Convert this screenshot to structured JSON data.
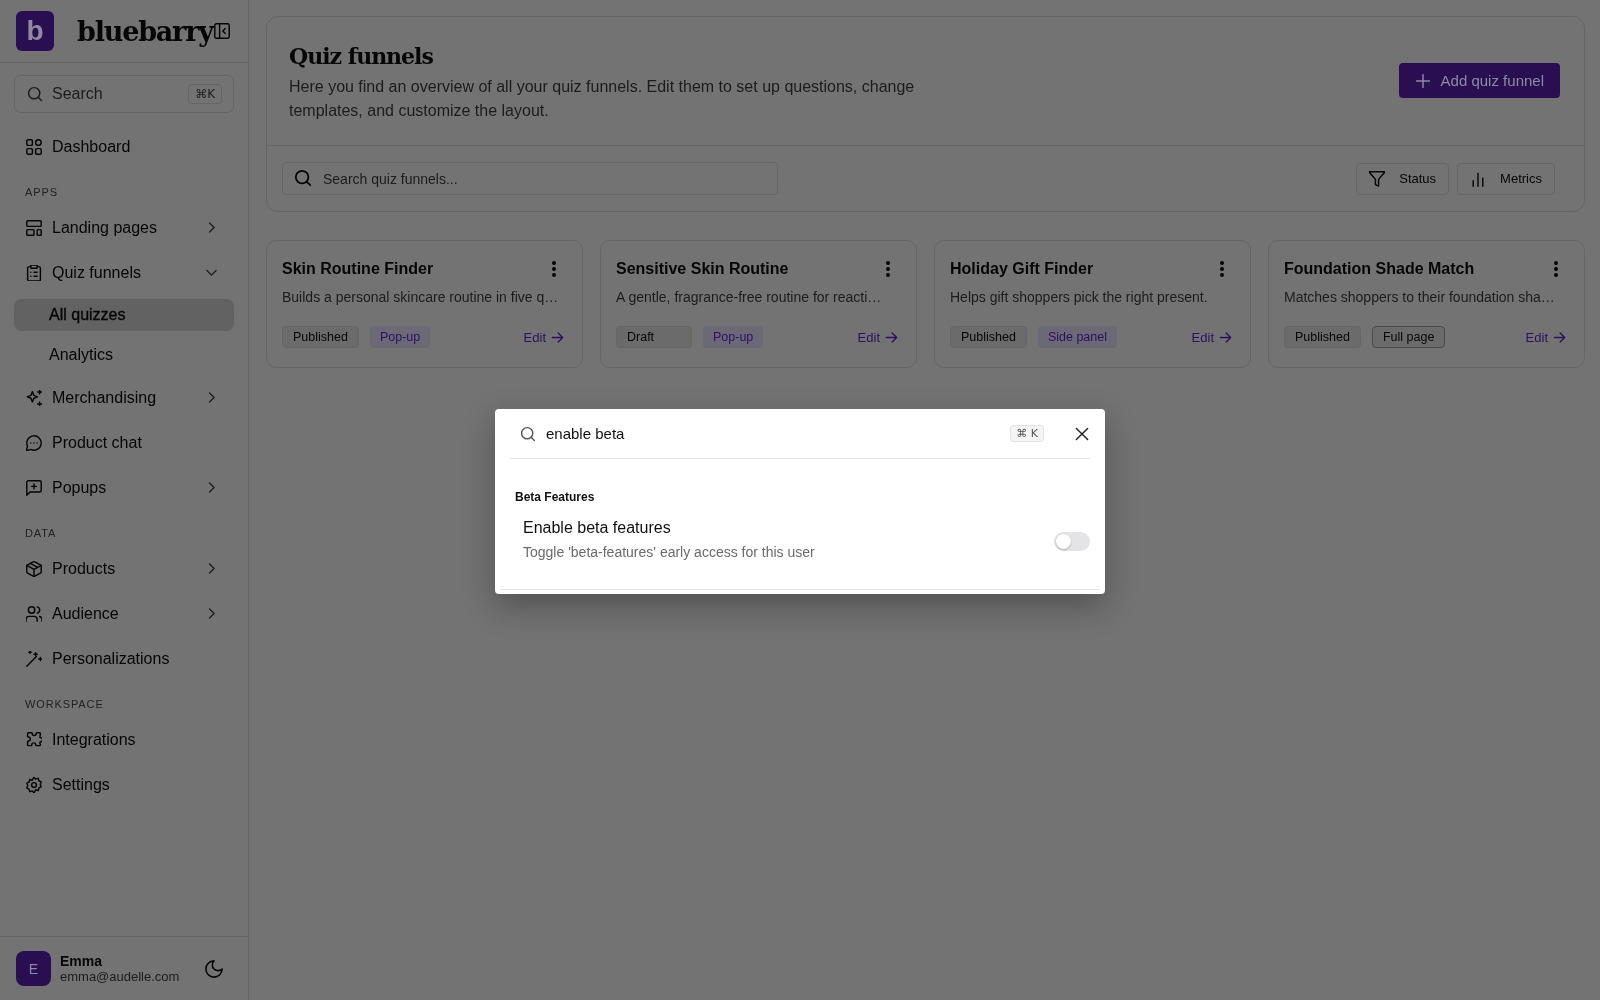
{
  "sidebar": {
    "logo_letter": "b",
    "brand": "bluebarry",
    "search": {
      "placeholder": "Search",
      "shortcut": "⌘K"
    },
    "sections": [
      {
        "items": [
          {
            "label": "Dashboard",
            "kind": "link",
            "selected": false
          }
        ]
      },
      {
        "label": "APPS",
        "items": [
          {
            "label": "Landing pages",
            "kind": "menu",
            "expanded": false,
            "selected": false
          },
          {
            "label": "Quiz funnels",
            "kind": "menu",
            "expanded": true,
            "selected": false,
            "children": [
              {
                "label": "All quizzes",
                "selected": true
              },
              {
                "label": "Analytics",
                "selected": false
              }
            ]
          },
          {
            "label": "Merchandising",
            "kind": "menu",
            "expanded": false,
            "selected": false
          },
          {
            "label": "Product chat",
            "kind": "link",
            "selected": false
          },
          {
            "label": "Popups",
            "kind": "menu",
            "expanded": false,
            "selected": false
          }
        ]
      },
      {
        "label": "DATA",
        "items": [
          {
            "label": "Products",
            "kind": "menu",
            "expanded": false,
            "selected": false
          },
          {
            "label": "Audience",
            "kind": "menu",
            "expanded": false,
            "selected": false
          },
          {
            "label": "Personalizations",
            "kind": "link",
            "selected": false
          }
        ]
      },
      {
        "label": "WORKSPACE",
        "items": [
          {
            "label": "Integrations",
            "kind": "link",
            "selected": false
          },
          {
            "label": "Settings",
            "kind": "link",
            "selected": false
          }
        ]
      }
    ],
    "user": {
      "avatar_letter": "E",
      "name": "Emma",
      "email": "emma@audelle.com"
    }
  },
  "header": {
    "title": "Quiz funnels",
    "description": "Here you find an overview of all your quiz funnels. Edit them to set up questions, change templates, and customize the layout.",
    "action": "Add quiz funnel"
  },
  "toolbar": {
    "search": {
      "placeholder": "Search quiz funnels..."
    },
    "filters": [
      {
        "label": "Status"
      },
      {
        "label": "Metrics"
      }
    ]
  },
  "cards": [
    {
      "title": "Skin Routine Finder",
      "description": "Builds a personal skincare routine in five q…",
      "badges": [
        {
          "label": "Published",
          "kind": "status"
        },
        {
          "label": "Pop-up",
          "kind": "accent"
        }
      ],
      "link": "Edit"
    },
    {
      "title": "Sensitive Skin Routine",
      "description": "A gentle, fragrance-free routine for reacti…",
      "badges": [
        {
          "label": "Draft",
          "kind": "status"
        },
        {
          "label": "Pop-up",
          "kind": "accent"
        }
      ],
      "link": "Edit"
    },
    {
      "title": "Holiday Gift Finder",
      "description": "Helps gift shoppers pick the right present.",
      "badges": [
        {
          "label": "Published",
          "kind": "status"
        },
        {
          "label": "Side panel",
          "kind": "accent"
        }
      ],
      "link": "Edit"
    },
    {
      "title": "Foundation Shade Match",
      "description": "Matches shoppers to their foundation sha…",
      "badges": [
        {
          "label": "Published",
          "kind": "status"
        },
        {
          "label": "Full page",
          "kind": "outline"
        }
      ],
      "link": "Edit"
    }
  ],
  "command_palette": {
    "query": "enable beta",
    "shortcut": "⌘ K",
    "groups": [
      {
        "heading": "Beta Features",
        "items": [
          {
            "title": "Enable beta features",
            "description": "Toggle 'beta-features' early access for this user",
            "kind": "toggle",
            "on": false
          }
        ]
      }
    ]
  }
}
